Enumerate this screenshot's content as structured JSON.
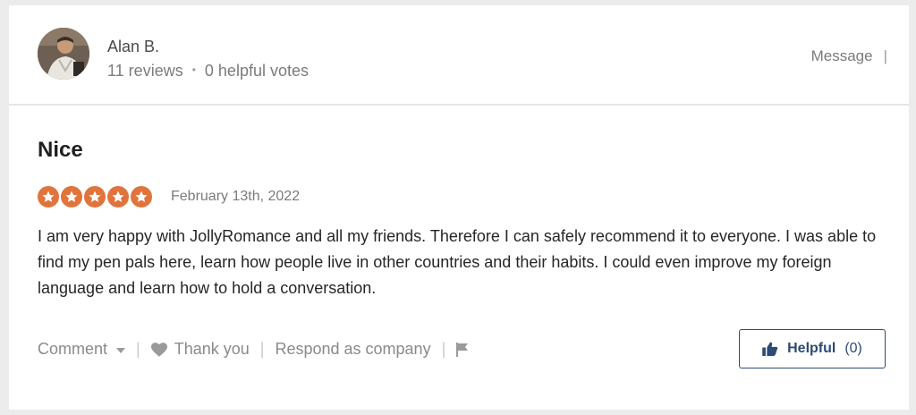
{
  "reviewer": {
    "name": "Alan B.",
    "reviews_count": "11 reviews",
    "helpful_votes": "0 helpful votes",
    "message_label": "Message",
    "message_separator": "|"
  },
  "review": {
    "title": "Nice",
    "rating": 5,
    "date": "February 13th, 2022",
    "text": "I am very happy with JollyRomance and all my friends. Therefore I can safely recommend it to everyone. I was able to find my pen pals here, learn how people live in other countries and their habits. I could even improve my foreign language and learn how to hold a conversation."
  },
  "actions": {
    "comment_label": "Comment",
    "thank_you_label": "Thank you",
    "respond_label": "Respond as company",
    "helpful_label": "Helpful",
    "helpful_count": "(0)"
  },
  "colors": {
    "star": "#e0743c",
    "button_accent": "#2d4b73"
  }
}
